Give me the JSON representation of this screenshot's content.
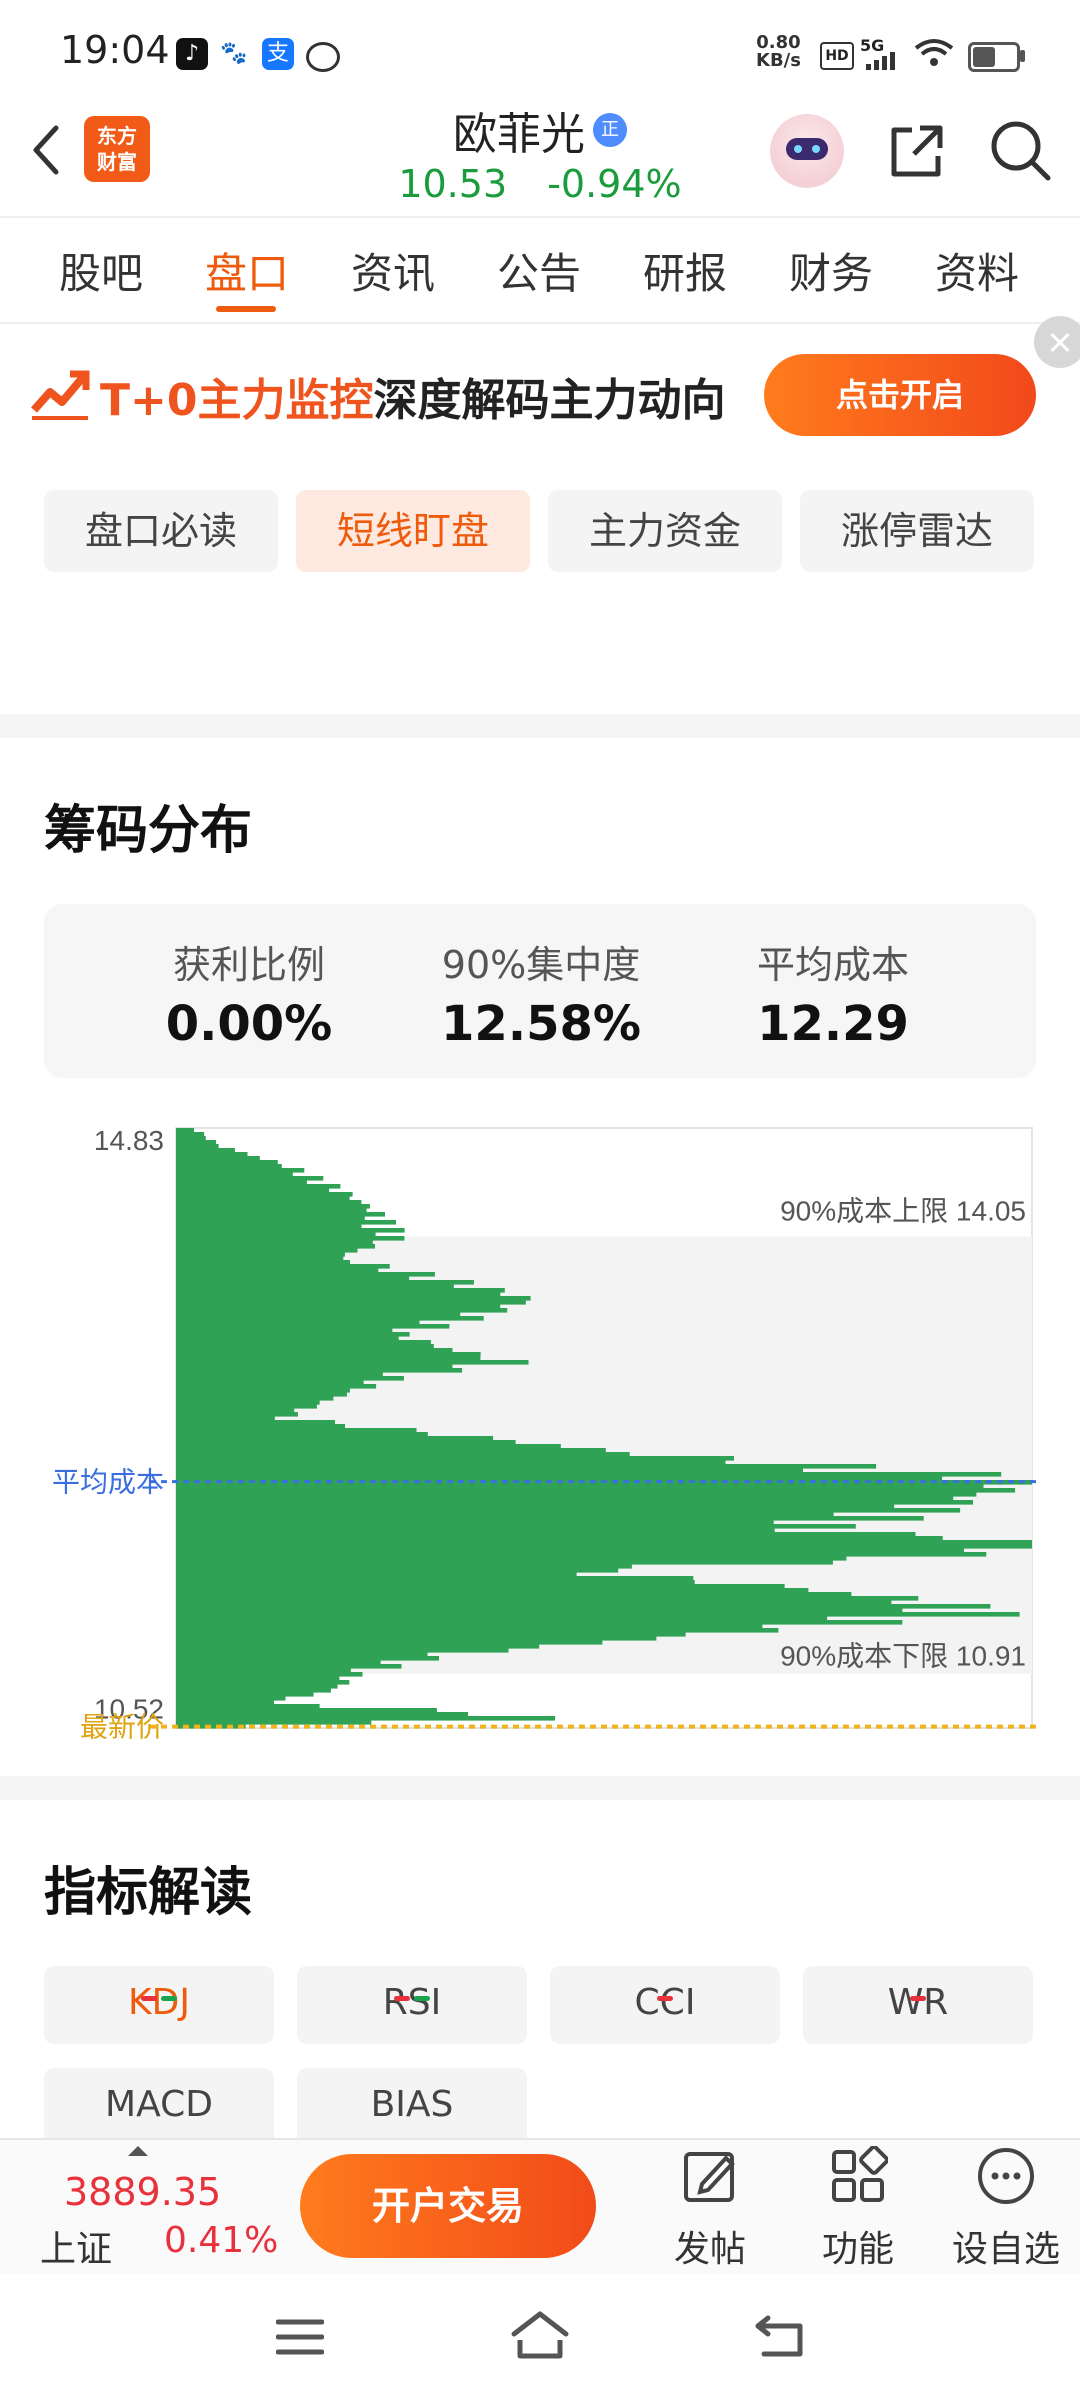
{
  "status_bar": {
    "time": "19:04",
    "net_speed_value": "0.80",
    "net_speed_unit": "KB/s",
    "hd": "HD",
    "signal": "5G",
    "app_icons": [
      "douyin-icon",
      "baidu-icon",
      "alipay-icon",
      "speedtest-icon"
    ]
  },
  "header": {
    "logo_line1": "东方",
    "logo_line2": "财富",
    "stock_name": "欧菲光",
    "badge": "正",
    "price": "10.53",
    "change_pct": "-0.94%",
    "colors": {
      "down": "#1a9b3c",
      "accent": "#ef5b0c"
    }
  },
  "tabs": [
    "股吧",
    "盘口",
    "资讯",
    "公告",
    "研报",
    "财务",
    "资料"
  ],
  "active_tab": "盘口",
  "banner": {
    "title_highlight": "T+0主力监控",
    "title_rest": "深度解码主力动向",
    "button": "点击开启"
  },
  "sub_tabs": [
    "盘口必读",
    "短线盯盘",
    "主力资金",
    "涨停雷达"
  ],
  "active_sub_tab": "短线盯盘",
  "chip_distribution": {
    "title": "筹码分布",
    "stats": [
      {
        "label": "获利比例",
        "value": "0.00%"
      },
      {
        "label": "90%集中度",
        "value": "12.58%"
      },
      {
        "label": "平均成本",
        "value": "12.29"
      }
    ],
    "y_top_label": "14.83",
    "y_bottom_label": "10.52",
    "upper_label": "90%成本上限 14.05",
    "lower_label": "90%成本下限 10.91",
    "avg_cost_label": "平均成本",
    "latest_price_label": "最新价"
  },
  "chart_data": {
    "type": "area",
    "orientation": "horizontal",
    "ylim": [
      10.52,
      14.83
    ],
    "cost_upper_90": 14.05,
    "cost_lower_90": 10.91,
    "avg_cost": 12.29,
    "latest_price": 10.53,
    "series": [
      {
        "values": [
          [
            14.83,
            0.02
          ],
          [
            14.7,
            0.05
          ],
          [
            14.55,
            0.13
          ],
          [
            14.4,
            0.18
          ],
          [
            14.25,
            0.22
          ],
          [
            14.05,
            0.25
          ],
          [
            13.9,
            0.18
          ],
          [
            13.75,
            0.3
          ],
          [
            13.6,
            0.4
          ],
          [
            13.45,
            0.32
          ],
          [
            13.35,
            0.25
          ],
          [
            13.25,
            0.3
          ],
          [
            13.15,
            0.38
          ],
          [
            13.05,
            0.25
          ],
          [
            12.9,
            0.18
          ],
          [
            12.75,
            0.12
          ],
          [
            12.6,
            0.35
          ],
          [
            12.5,
            0.5
          ],
          [
            12.4,
            0.75
          ],
          [
            12.3,
            0.98
          ],
          [
            12.2,
            0.9
          ],
          [
            12.05,
            0.82
          ],
          [
            11.95,
            0.7
          ],
          [
            11.85,
            0.98
          ],
          [
            11.75,
            0.85
          ],
          [
            11.65,
            0.45
          ],
          [
            11.55,
            0.65
          ],
          [
            11.45,
            0.82
          ],
          [
            11.35,
            0.92
          ],
          [
            11.2,
            0.6
          ],
          [
            11.05,
            0.3
          ],
          [
            10.91,
            0.2
          ],
          [
            10.8,
            0.18
          ],
          [
            10.7,
            0.1
          ],
          [
            10.6,
            0.45
          ],
          [
            10.53,
            0.05
          ]
        ]
      }
    ]
  },
  "indicators": {
    "title": "指标解读",
    "items": [
      {
        "label": "KDJ",
        "marks": [
          "r",
          "g"
        ]
      },
      {
        "label": "RSI",
        "marks": [
          "r",
          "g"
        ]
      },
      {
        "label": "CCI",
        "marks": [
          "r"
        ]
      },
      {
        "label": "WR",
        "marks": [
          "r"
        ]
      },
      {
        "label": "MACD",
        "marks": []
      },
      {
        "label": "BIAS",
        "marks": []
      }
    ],
    "active": "KDJ"
  },
  "bottom_bar": {
    "index_value": "3889.35",
    "index_name": "上证",
    "index_change": "0.41%",
    "trade_button": "开户交易",
    "actions": [
      "发帖",
      "功能",
      "设自选"
    ]
  }
}
